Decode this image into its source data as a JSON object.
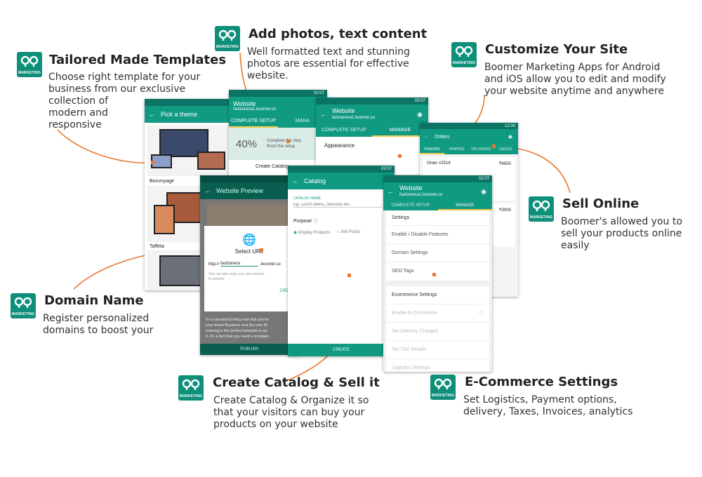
{
  "colors": {
    "brand": "#0e8f7a",
    "bar": "#109a82",
    "bar_dark": "#0b7464",
    "accent": "#e8772e",
    "tab_underline": "#f2c94c"
  },
  "logo_text": "MARKETING",
  "features": [
    {
      "title": "Tailored Made Templates",
      "desc": [
        "Choose right template for your",
        "business from our exclusive",
        "collection of",
        "modern and",
        "responsive"
      ]
    },
    {
      "title": "Add photos, text content",
      "desc": [
        "Well formatted text and stunning",
        "photos are essential for effective",
        "website."
      ]
    },
    {
      "title": "Customize Your Site",
      "desc": [
        "Boomer Marketing Apps for Android",
        "and iOS allow you to edit and modify",
        "your website anytime and anywhere"
      ]
    },
    {
      "title": "Sell Online",
      "desc": [
        "Boomer's allowed you to",
        "sell your products online",
        "easily"
      ]
    },
    {
      "title": "Domain Name",
      "desc": [
        "Register personalized",
        "domains to boost your"
      ]
    },
    {
      "title": "Create Catalog & Sell it",
      "desc": [
        "Create Catalog & Organize it so",
        "that your visitors can buy your",
        "products on your website"
      ]
    },
    {
      "title": "E-Commerce Settings",
      "desc": [
        "Set Logistics, Payment options,",
        "delivery, Taxes, Invoices, analytics"
      ]
    }
  ],
  "status": {
    "time": "02:07",
    "time_alt": "12:30"
  },
  "theme_screen": {
    "title": "Pick a theme",
    "themes": [
      "Bonvoyage",
      "Taffeta"
    ]
  },
  "website_screen": {
    "title": "Website",
    "subtitle": "fashionera1.boomer.co",
    "tabs": [
      "COMPLETE SETUP",
      "MANA"
    ],
    "progress": "40%",
    "progress_text": [
      "Complete the step",
      "finish the setup"
    ],
    "item": "Create Catalog"
  },
  "preview_screen": {
    "title": "Website Preview",
    "dialog_title": "Select URL",
    "url_prefix": "http://",
    "url_value": "fashionera",
    "url_suffix": ".boomer.co",
    "note": [
      "You can later map your own domain",
      "to website"
    ],
    "action": "CREA",
    "body": [
      "It's a wonderful thing now that you've",
      "your travel Business and the only thi",
      "missing is the perfect template to go",
      "it. It's a fact that you need a template"
    ],
    "publish": "PUBLISH"
  },
  "manage_screen": {
    "title": "Website",
    "subtitle": "fashionera1.boomer.co",
    "tabs": [
      "COMPLETE SETUP",
      "MANAGE"
    ],
    "item": "Appearance"
  },
  "orders_screen": {
    "title": "Orders",
    "tabs": [
      "PENDING",
      "SHIPPED",
      "DELIVERED",
      "CANCEL"
    ],
    "orders": [
      {
        "id": "Order #2516",
        "amount": "₹4650"
      },
      {
        "id": "",
        "amount": "₹3000"
      }
    ]
  },
  "catalog_screen": {
    "title": "Catalog",
    "label": "CATALOG NAME",
    "placeholder": "Eg. Lunch Menu, Services etc.",
    "purpose": "Purpose",
    "opt1": "Display Products",
    "opt2": "Sell Produ",
    "button": "CREATE"
  },
  "settings_screen": {
    "title": "Website",
    "subtitle": "fashionera1.boomer.co",
    "tabs": [
      "COMPLETE SETUP",
      "MANAGE"
    ],
    "items": [
      "Settings",
      "Enable / Disable Features",
      "Domain Settings",
      "SEO Tags"
    ],
    "ecom_title": "Ecommerce Settings",
    "ecom_items": [
      "Enable E-Commerce",
      "Set Delivery Charges",
      "Set TAX Details",
      "Logistics Settings"
    ]
  }
}
